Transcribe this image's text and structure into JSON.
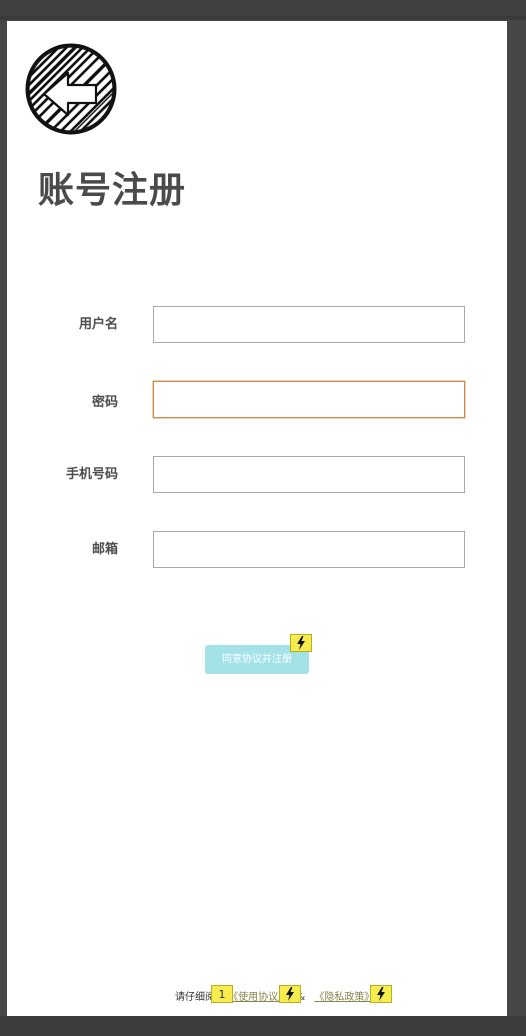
{
  "title": "账号注册",
  "back_button": {
    "icon": "back-arrow-icon"
  },
  "form": {
    "fields": [
      {
        "key": "username",
        "label": "用户名",
        "value": ""
      },
      {
        "key": "password",
        "label": "密码",
        "value": ""
      },
      {
        "key": "phone",
        "label": "手机号码",
        "value": ""
      },
      {
        "key": "email",
        "label": "邮箱",
        "value": ""
      }
    ],
    "submit_label": "同意协议并注册"
  },
  "footer": {
    "prefix": "请仔细阅读",
    "terms_link": "《使用协议》",
    "separator": "&",
    "privacy_link": "《隐私政策》"
  },
  "annotations": {
    "footer_marker_number": "1",
    "interaction_marker_icon": "lightning-icon"
  },
  "colors": {
    "background": "#474747",
    "canvas": "#ffffff",
    "title": "#4a4a4a",
    "focus_border": "#d08a4a",
    "button": "#a3e3e8",
    "marker": "#f6ec4e"
  }
}
